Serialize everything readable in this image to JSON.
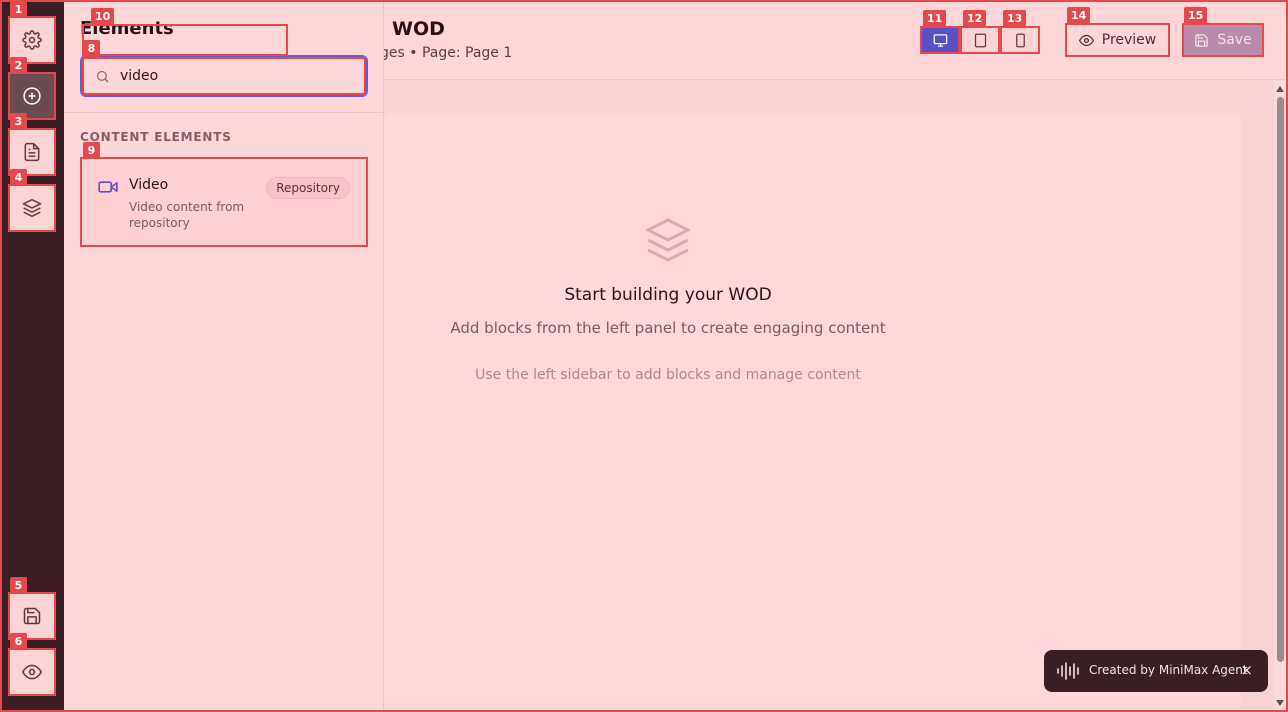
{
  "sidebar": {
    "buttons": [
      {
        "icon": "gear-icon",
        "marker": "1"
      },
      {
        "icon": "plus-circle-icon",
        "marker": "2"
      },
      {
        "icon": "file-text-icon",
        "marker": "3"
      },
      {
        "icon": "layers-icon",
        "marker": "4"
      },
      {
        "icon": "save-icon",
        "marker": "5"
      },
      {
        "icon": "eye-icon",
        "marker": "6"
      }
    ]
  },
  "panel": {
    "title": "Elements",
    "title_marker": "10",
    "search": {
      "value": "video",
      "marker": "8"
    },
    "section_label": "CONTENT ELEMENTS",
    "items": [
      {
        "name": "Video",
        "description": "Video content from repository",
        "badge": "Repository",
        "icon": "video-camera-icon",
        "marker": "9"
      }
    ]
  },
  "header": {
    "title": "WOD",
    "subtitle": "ges • Page: Page 1",
    "device_buttons": [
      {
        "icon": "desktop-icon",
        "marker": "11",
        "active": true
      },
      {
        "icon": "tablet-icon",
        "marker": "12",
        "active": false
      },
      {
        "icon": "mobile-icon",
        "marker": "13",
        "active": false
      }
    ],
    "preview_label": "Preview",
    "preview_marker": "14",
    "save_label": "Save",
    "save_marker": "15"
  },
  "canvas": {
    "empty_title": "Start building your WOD",
    "empty_subtitle": "Add blocks from the left panel to create engaging content",
    "empty_hint": "Use the left sidebar to add blocks and manage content"
  },
  "toast": {
    "text": "Created by MiniMax Agent",
    "close": "×"
  },
  "colors": {
    "rail": "#3b1d24",
    "accent": "#5b4fc4",
    "highlight": "#e5484d",
    "background": "#fed6d7"
  }
}
